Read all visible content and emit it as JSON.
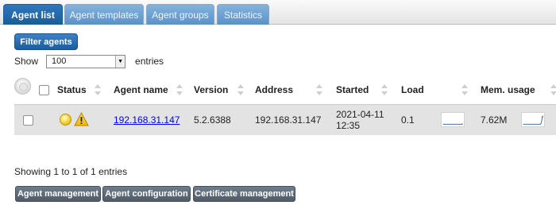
{
  "tabs": [
    {
      "label": "Agent list",
      "active": true
    },
    {
      "label": "Agent templates",
      "active": false
    },
    {
      "label": "Agent groups",
      "active": false
    },
    {
      "label": "Statistics",
      "active": false
    }
  ],
  "filter_button": "Filter agents",
  "show": {
    "label": "Show",
    "selected": "100",
    "suffix": "entries"
  },
  "table": {
    "columns": [
      "Status",
      "Agent name",
      "Version",
      "Address",
      "Started",
      "Load",
      "Mem. usage"
    ],
    "rows": [
      {
        "status_icons": [
          "yellow-status-ball-icon",
          "warning-triangle-icon"
        ],
        "agent_name": "192.168.31.147",
        "version": "5.2.6388",
        "address": "192.168.31.147",
        "started_date": "2021-04-11",
        "started_time": "12:35",
        "load": "0.1",
        "mem_usage": "7.62M"
      }
    ]
  },
  "showing_text": "Showing 1 to 1 of 1 entries",
  "bottom_buttons": [
    "Agent management",
    "Agent configuration",
    "Certificate management"
  ],
  "colors": {
    "tab_active": "#1f64a6",
    "tab_inactive": "#6fa3d4",
    "filter_button": "#2a70b4",
    "bottom_button": "#5d6975",
    "row_background": "#e3e3e3",
    "link": "#0000ee",
    "sparkline": "#2a5db0"
  }
}
